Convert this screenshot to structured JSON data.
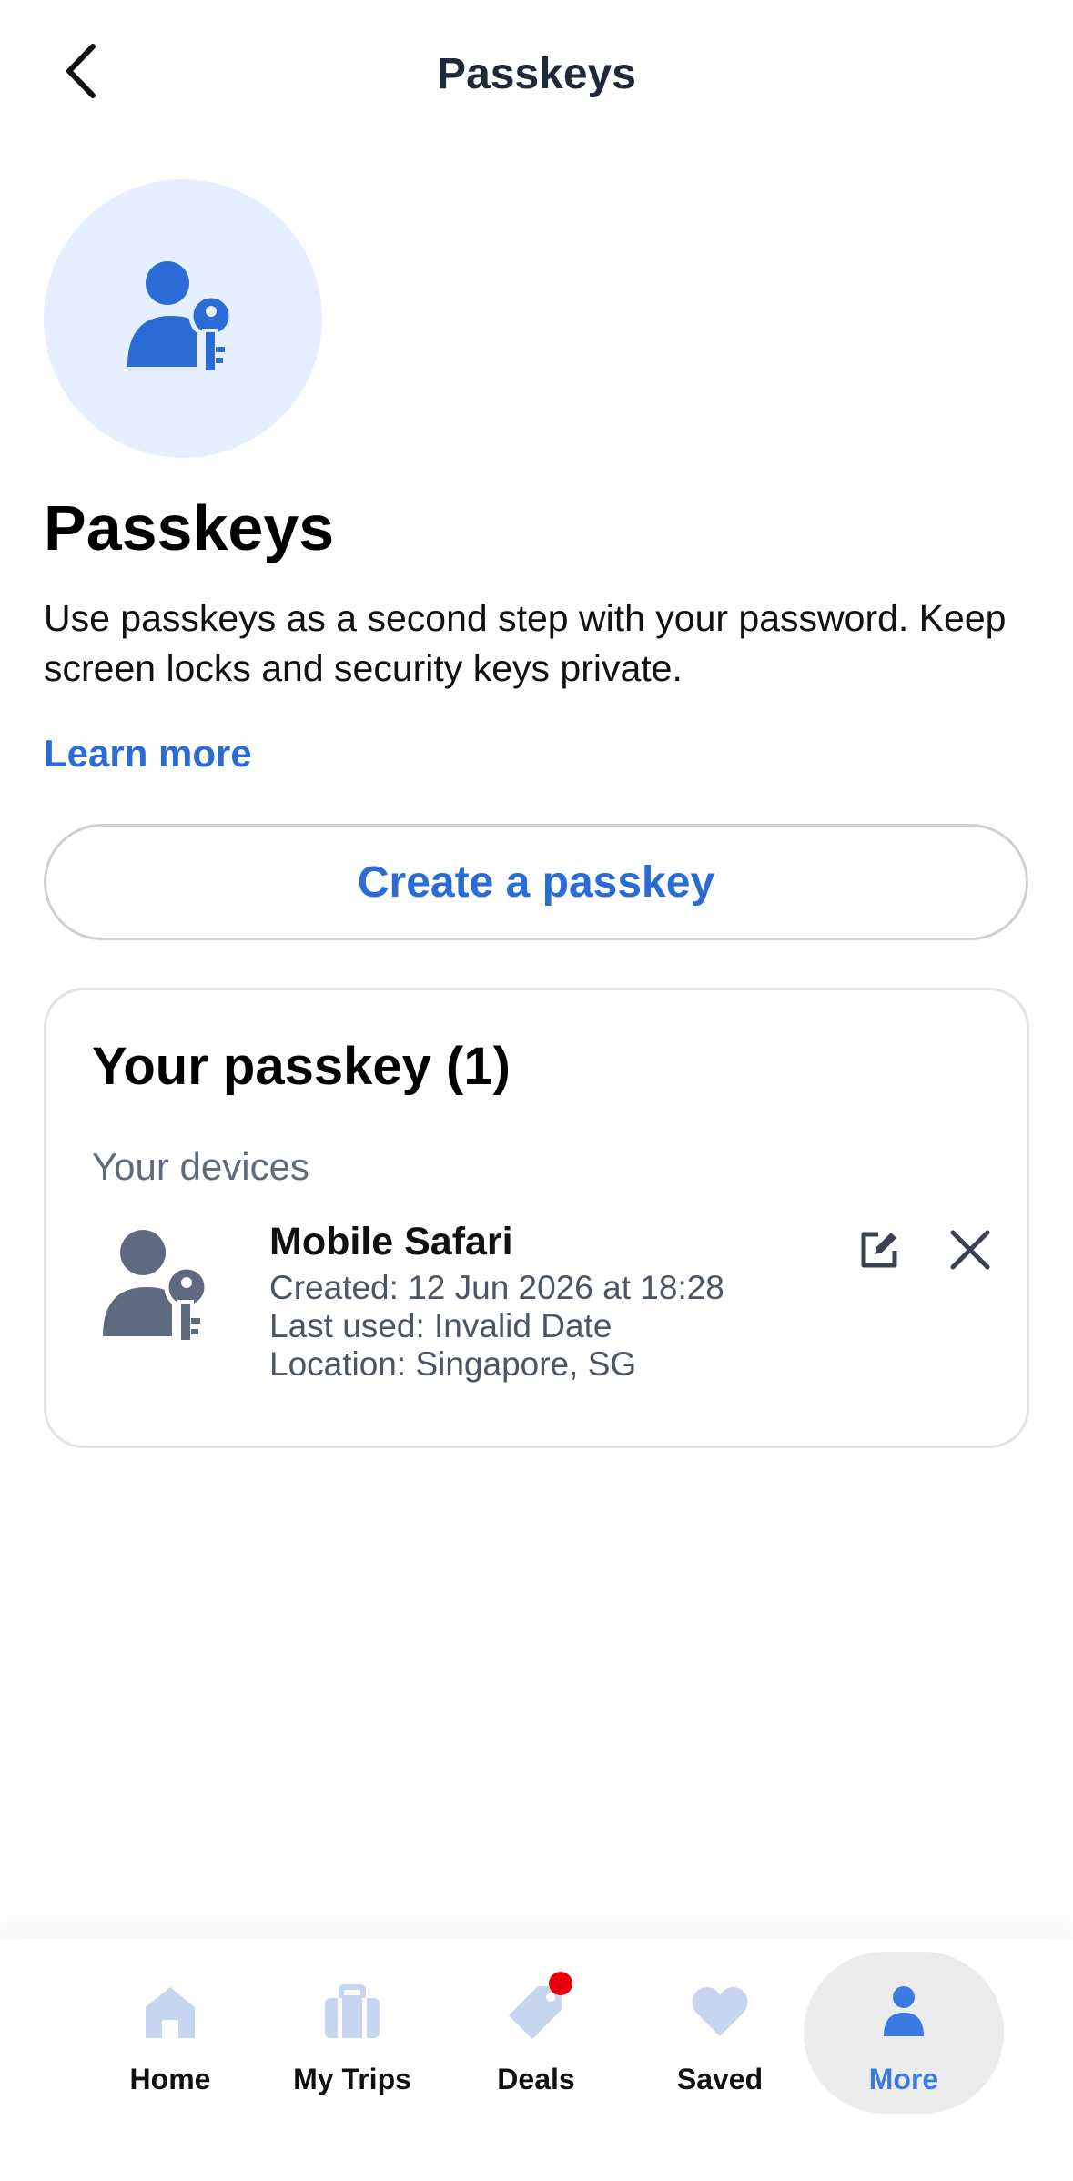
{
  "header": {
    "title": "Passkeys",
    "back_icon": "chevron-left-icon"
  },
  "hero": {
    "icon": "person-key-icon",
    "circle_color": "#e6efff",
    "icon_color": "#2a6bd6"
  },
  "intro": {
    "title": "Passkeys",
    "description": "Use passkeys as a second step with your password. Keep screen locks and security keys private.",
    "learn_more": "Learn more"
  },
  "create_button": {
    "label": "Create a passkey"
  },
  "passkey_card": {
    "title": "Your passkey (1)",
    "section_label": "Your devices",
    "devices": [
      {
        "name": "Mobile Safari",
        "created": "Created: 12 Jun 2026 at 18:28",
        "last_used": "Last used: Invalid Date",
        "location": "Location: Singapore, SG",
        "icon": "person-key-icon",
        "actions": [
          "edit-icon",
          "close-icon"
        ]
      }
    ]
  },
  "bottom_nav": {
    "active": "More",
    "items": [
      {
        "label": "Home",
        "icon": "home-icon"
      },
      {
        "label": "My Trips",
        "icon": "briefcase-icon"
      },
      {
        "label": "Deals",
        "icon": "tag-icon",
        "has_notification": true
      },
      {
        "label": "Saved",
        "icon": "heart-icon"
      },
      {
        "label": "More",
        "icon": "person-icon"
      }
    ]
  },
  "colors": {
    "accent": "#2a6bd6",
    "nav_inactive_icon": "#c6d6ee",
    "nav_active": "#3b7ae3",
    "notification": "#e8000f",
    "device_icon": "#5d6a80"
  }
}
